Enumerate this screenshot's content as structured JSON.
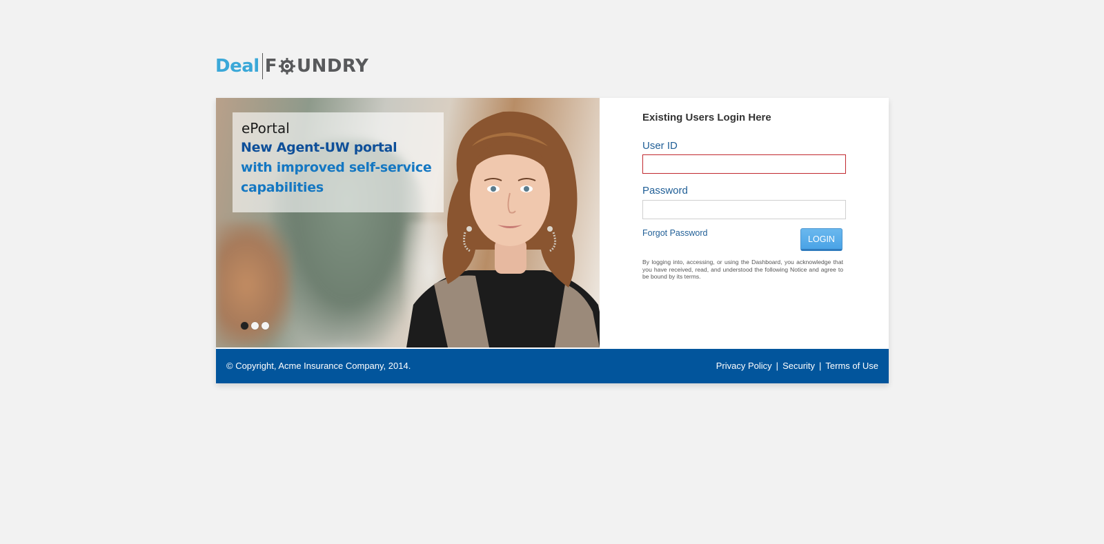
{
  "brand": {
    "logo_part1": "Deal",
    "logo_part2_prefix": "F",
    "logo_part2_suffix": "UNDRY",
    "accent_color": "#3ba8d8",
    "primary_color": "#02559c"
  },
  "hero": {
    "caption_title": "ePortal",
    "caption_line1": "New Agent-UW portal",
    "caption_line2": "with improved self-service",
    "caption_line3": "capabilities",
    "slides_total": 3,
    "active_slide": 1
  },
  "login": {
    "heading": "Existing Users Login Here",
    "user_id_label": "User ID",
    "user_id_value": "",
    "password_label": "Password",
    "password_value": "",
    "forgot_label": "Forgot Password",
    "login_button": "LOGIN",
    "notice": "By logging into, accessing, or using the Dashboard, you acknowledge that you have received, read, and understood the following Notice and agree to be bound by its terms."
  },
  "footer": {
    "copyright": "© Copyright, Acme Insurance Company, 2014.",
    "links": [
      "Privacy Policy",
      "Security",
      "Terms of Use"
    ],
    "separator": "|"
  }
}
